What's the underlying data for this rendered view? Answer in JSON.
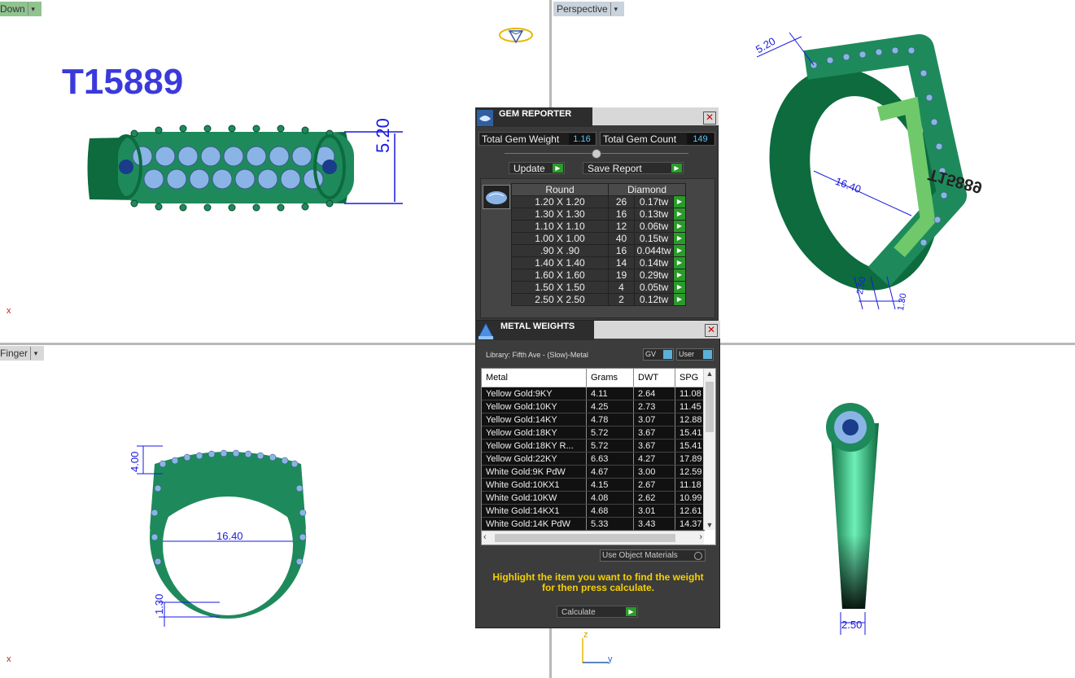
{
  "viewports": {
    "top_left": {
      "label": "Down",
      "title": "T15889",
      "dims": [
        "5.20"
      ],
      "axis": "x"
    },
    "top_right": {
      "label": "Perspective",
      "dims": [
        "5.20",
        "16.40",
        "2.50",
        "1.30"
      ],
      "engraving": "T15889"
    },
    "bottom_left": {
      "label": "Finger",
      "dims": [
        "4.00",
        "16.40",
        "1.30"
      ],
      "axis": "x"
    },
    "bottom_right": {
      "dims": [
        "2.50"
      ],
      "axis_z": "z",
      "axis_y": "y"
    }
  },
  "gem_reporter": {
    "title": "GEM REPORTER",
    "close_label": "✕",
    "total_weight_label": "Total Gem Weight",
    "total_weight": "1.16",
    "total_count_label": "Total Gem Count",
    "total_count": "149",
    "update_label": "Update",
    "save_report_label": "Save Report",
    "col_shape": "Round",
    "col_type": "Diamond",
    "rows": [
      {
        "size": "1.20 X 1.20",
        "count": "26",
        "weight": "0.17tw"
      },
      {
        "size": "1.30 X 1.30",
        "count": "16",
        "weight": "0.13tw"
      },
      {
        "size": "1.10 X 1.10",
        "count": "12",
        "weight": "0.06tw"
      },
      {
        "size": "1.00 X 1.00",
        "count": "40",
        "weight": "0.15tw"
      },
      {
        "size": ".90 X .90",
        "count": "16",
        "weight": "0.044tw"
      },
      {
        "size": "1.40 X 1.40",
        "count": "14",
        "weight": "0.14tw"
      },
      {
        "size": "1.60 X 1.60",
        "count": "19",
        "weight": "0.29tw"
      },
      {
        "size": "1.50 X 1.50",
        "count": "4",
        "weight": "0.05tw"
      },
      {
        "size": "2.50 X 2.50",
        "count": "2",
        "weight": "0.12tw"
      }
    ]
  },
  "metal_weights": {
    "title": "METAL WEIGHTS",
    "close_label": "✕",
    "library": "Library: Fifth Ave - (Slow)-Metal",
    "gv_label": "GV",
    "user_label": "User",
    "columns": [
      "Metal",
      "Grams",
      "DWT",
      "SPG"
    ],
    "rows": [
      [
        "Yellow Gold:9KY",
        "4.11",
        "2.64",
        "11.08"
      ],
      [
        "Yellow Gold:10KY",
        "4.25",
        "2.73",
        "11.45"
      ],
      [
        "Yellow Gold:14KY",
        "4.78",
        "3.07",
        "12.88"
      ],
      [
        "Yellow Gold:18KY",
        "5.72",
        "3.67",
        "15.41"
      ],
      [
        "Yellow Gold:18KY R...",
        "5.72",
        "3.67",
        "15.41"
      ],
      [
        "Yellow Gold:22KY",
        "6.63",
        "4.27",
        "17.89"
      ],
      [
        "White Gold:9K PdW",
        "4.67",
        "3.00",
        "12.59"
      ],
      [
        "White Gold:10KX1",
        "4.15",
        "2.67",
        "11.18"
      ],
      [
        "White Gold:10KW",
        "4.08",
        "2.62",
        "10.99"
      ],
      [
        "White Gold:14KX1",
        "4.68",
        "3.01",
        "12.61"
      ],
      [
        "White Gold:14K PdW",
        "5.33",
        "3.43",
        "14.37"
      ]
    ],
    "use_object_materials": "Use Object Materials",
    "hint": "Highlight the item you want to find the weight for then press calculate.",
    "calculate_label": "Calculate"
  },
  "colors": {
    "ring": "#1e8a5c",
    "gem": "#8ab4e6",
    "dimension": "#1a1ae0",
    "title": "#3a3adc",
    "accent": "#57c6ff",
    "go": "#2a9b2a"
  }
}
